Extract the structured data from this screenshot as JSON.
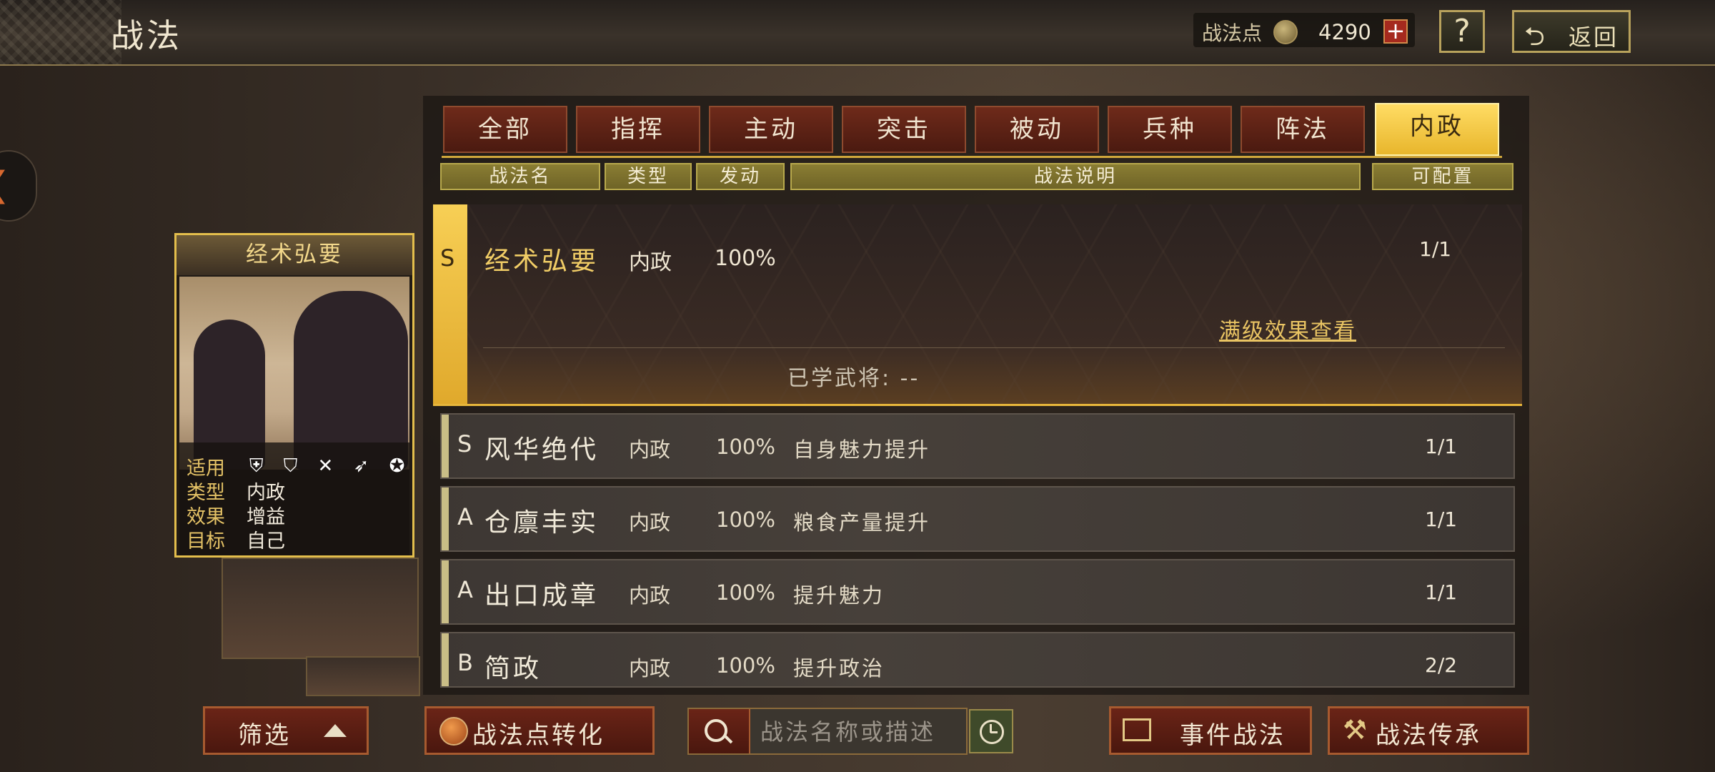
{
  "header": {
    "title": "战法",
    "points_label": "战法点",
    "points_value": "4290",
    "plus": "+",
    "help": "?",
    "back_label": "返回"
  },
  "tabs": [
    {
      "label": "全部",
      "active": false
    },
    {
      "label": "指挥",
      "active": false
    },
    {
      "label": "主动",
      "active": false
    },
    {
      "label": "突击",
      "active": false
    },
    {
      "label": "被动",
      "active": false
    },
    {
      "label": "兵种",
      "active": false
    },
    {
      "label": "阵法",
      "active": false
    },
    {
      "label": "内政",
      "active": true
    }
  ],
  "columns": [
    "战法名",
    "类型",
    "发动",
    "战法说明",
    "可配置"
  ],
  "card": {
    "title": "经术弘要",
    "rows": [
      {
        "key": "适用",
        "value": ""
      },
      {
        "key": "类型",
        "value": "内政"
      },
      {
        "key": "效果",
        "value": "增益"
      },
      {
        "key": "目标",
        "value": "自己"
      }
    ],
    "troop_icons": "⛨ ⛉ ✕ ➶ ✪"
  },
  "selected": {
    "grade": "S",
    "name": "经术弘要",
    "type": "内政",
    "rate": "100%",
    "count": "1/1",
    "max_link": "满级效果查看",
    "learned": "已学武将: --"
  },
  "rows": [
    {
      "grade": "S",
      "name": "风华绝代",
      "type": "内政",
      "rate": "100%",
      "desc": "自身魅力提升",
      "count": "1/1"
    },
    {
      "grade": "A",
      "name": "仓廪丰实",
      "type": "内政",
      "rate": "100%",
      "desc": "粮食产量提升",
      "count": "1/1"
    },
    {
      "grade": "A",
      "name": "出口成章",
      "type": "内政",
      "rate": "100%",
      "desc": "提升魅力",
      "count": "1/1"
    },
    {
      "grade": "B",
      "name": "简政",
      "type": "内政",
      "rate": "100%",
      "desc": "提升政治",
      "count": "2/2"
    }
  ],
  "bottom": {
    "filter": "筛选",
    "convert": "战法点转化",
    "search_placeholder": "战法名称或描述",
    "event": "事件战法",
    "inherit": "战法传承"
  },
  "colors": {
    "accent_gold": "#e8b62c",
    "tab_red": "#6e2a1a",
    "header_olive": "#8a7d33"
  }
}
